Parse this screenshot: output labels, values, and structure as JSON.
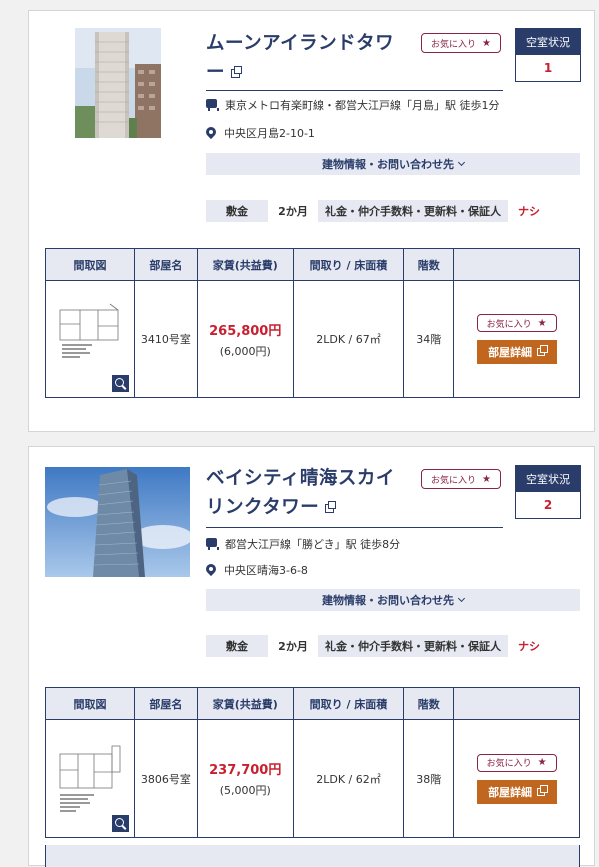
{
  "listings": [
    {
      "name": "ムーンアイランドタワー",
      "favorite_label": "お気に入り",
      "vacancy_label": "空室状況",
      "vacancy_count": "1",
      "station": "東京メトロ有楽町線・都営大江戸線「月島」駅 徒歩1分",
      "address": "中央区月島2-10-1",
      "info_button": "建物情報・お問い合わせ先",
      "deposit_label": "敷金",
      "deposit_value": "2か月",
      "fees_label": "礼金・仲介手数料・更新料・保証人",
      "fees_value": "ナシ",
      "table_headers": [
        "間取図",
        "部屋名",
        "家賃(共益費)",
        "間取り / 床面積",
        "階数",
        ""
      ],
      "room": {
        "name": "3410号室",
        "rent": "265,800円",
        "fee": "(6,000円)",
        "layout": "2LDK / 67㎡",
        "floor": "34階",
        "favorite_label": "お気に入り",
        "detail_label": "部屋詳細"
      }
    },
    {
      "name": "ベイシティ晴海スカイリンクタワー",
      "favorite_label": "お気に入り",
      "vacancy_label": "空室状況",
      "vacancy_count": "2",
      "station": "都営大江戸線「勝どき」駅 徒歩8分",
      "address": "中央区晴海3-6-8",
      "info_button": "建物情報・お問い合わせ先",
      "deposit_label": "敷金",
      "deposit_value": "2か月",
      "fees_label": "礼金・仲介手数料・更新料・保証人",
      "fees_value": "ナシ",
      "table_headers": [
        "間取図",
        "部屋名",
        "家賃(共益費)",
        "間取り / 床面積",
        "階数",
        ""
      ],
      "room": {
        "name": "3806号室",
        "rent": "237,700円",
        "fee": "(5,000円)",
        "layout": "2LDK / 62㎡",
        "floor": "38階",
        "favorite_label": "お気に入り",
        "detail_label": "部屋詳細"
      }
    }
  ]
}
